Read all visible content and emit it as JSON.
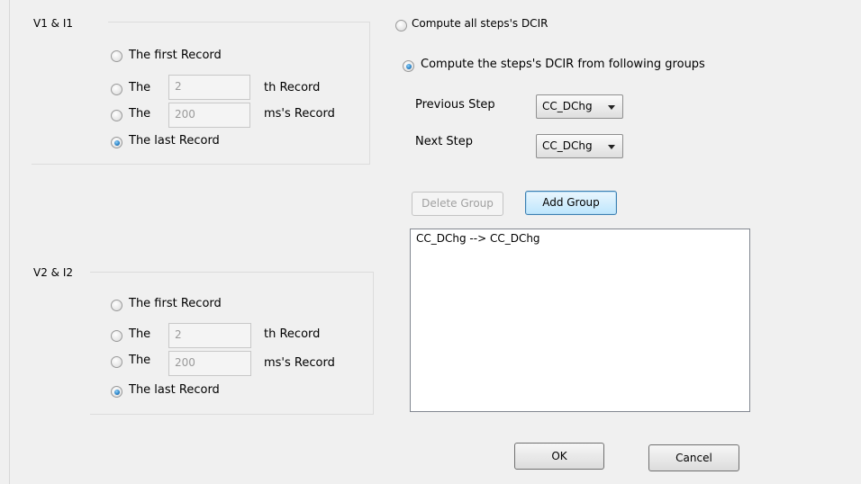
{
  "group1": {
    "title": "V1 & I1",
    "opt_first": "The first Record",
    "opt_nth_prefix": "The",
    "opt_nth_value": "2",
    "opt_nth_suffix": "th Record",
    "opt_ms_prefix": "The",
    "opt_ms_value": "200",
    "opt_ms_suffix": "ms's Record",
    "opt_last": "The last Record",
    "selected": "last"
  },
  "group2": {
    "title": "V2 & I2",
    "opt_first": "The first Record",
    "opt_nth_prefix": "The",
    "opt_nth_value": "2",
    "opt_nth_suffix": "th Record",
    "opt_ms_prefix": "The",
    "opt_ms_value": "200",
    "opt_ms_suffix": "ms's Record",
    "opt_last": "The last Record",
    "selected": "last"
  },
  "dcir": {
    "opt_all": "Compute all steps's DCIR",
    "opt_groups": "Compute the steps's DCIR from following groups",
    "selected": "groups",
    "previous_step_label": "Previous Step",
    "previous_step_value": "CC_DChg",
    "next_step_label": "Next Step",
    "next_step_value": "CC_DChg",
    "delete_group_label": "Delete Group",
    "add_group_label": "Add Group",
    "groups": [
      "CC_DChg --> CC_DChg"
    ]
  },
  "footer": {
    "ok_label": "OK",
    "cancel_label": "Cancel"
  }
}
